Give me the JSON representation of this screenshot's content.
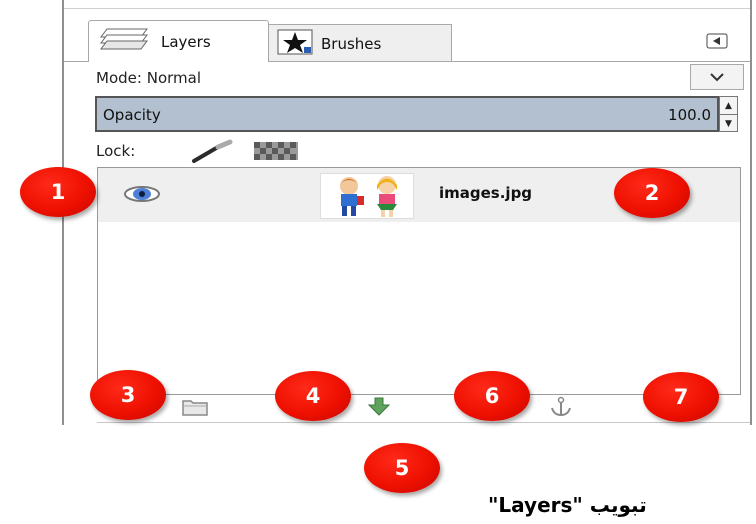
{
  "tabs": [
    {
      "label": "Layers",
      "icon": "layers-icon"
    },
    {
      "label": "Brushes",
      "icon": "brushes-icon"
    }
  ],
  "mode": {
    "label": "Mode:",
    "value": "Normal"
  },
  "opacity": {
    "label": "Opacity",
    "value": "100.0"
  },
  "lock": {
    "label": "Lock:"
  },
  "layers": [
    {
      "name": "images.jpg",
      "visible": true
    }
  ],
  "bottom_buttons": [
    "new-layer-icon",
    "new-group-icon",
    "raise-layer-icon",
    "lower-layer-icon",
    "duplicate-layer-icon",
    "anchor-layer-icon",
    "delete-layer-icon"
  ],
  "callouts": [
    "1",
    "2",
    "3",
    "4",
    "5",
    "6",
    "7"
  ],
  "caption": "تبويب \"Layers\"",
  "colors": {
    "callout": "#ee1000",
    "opacity_bar": "#b2c0cf",
    "selected_row": "#efefef"
  }
}
